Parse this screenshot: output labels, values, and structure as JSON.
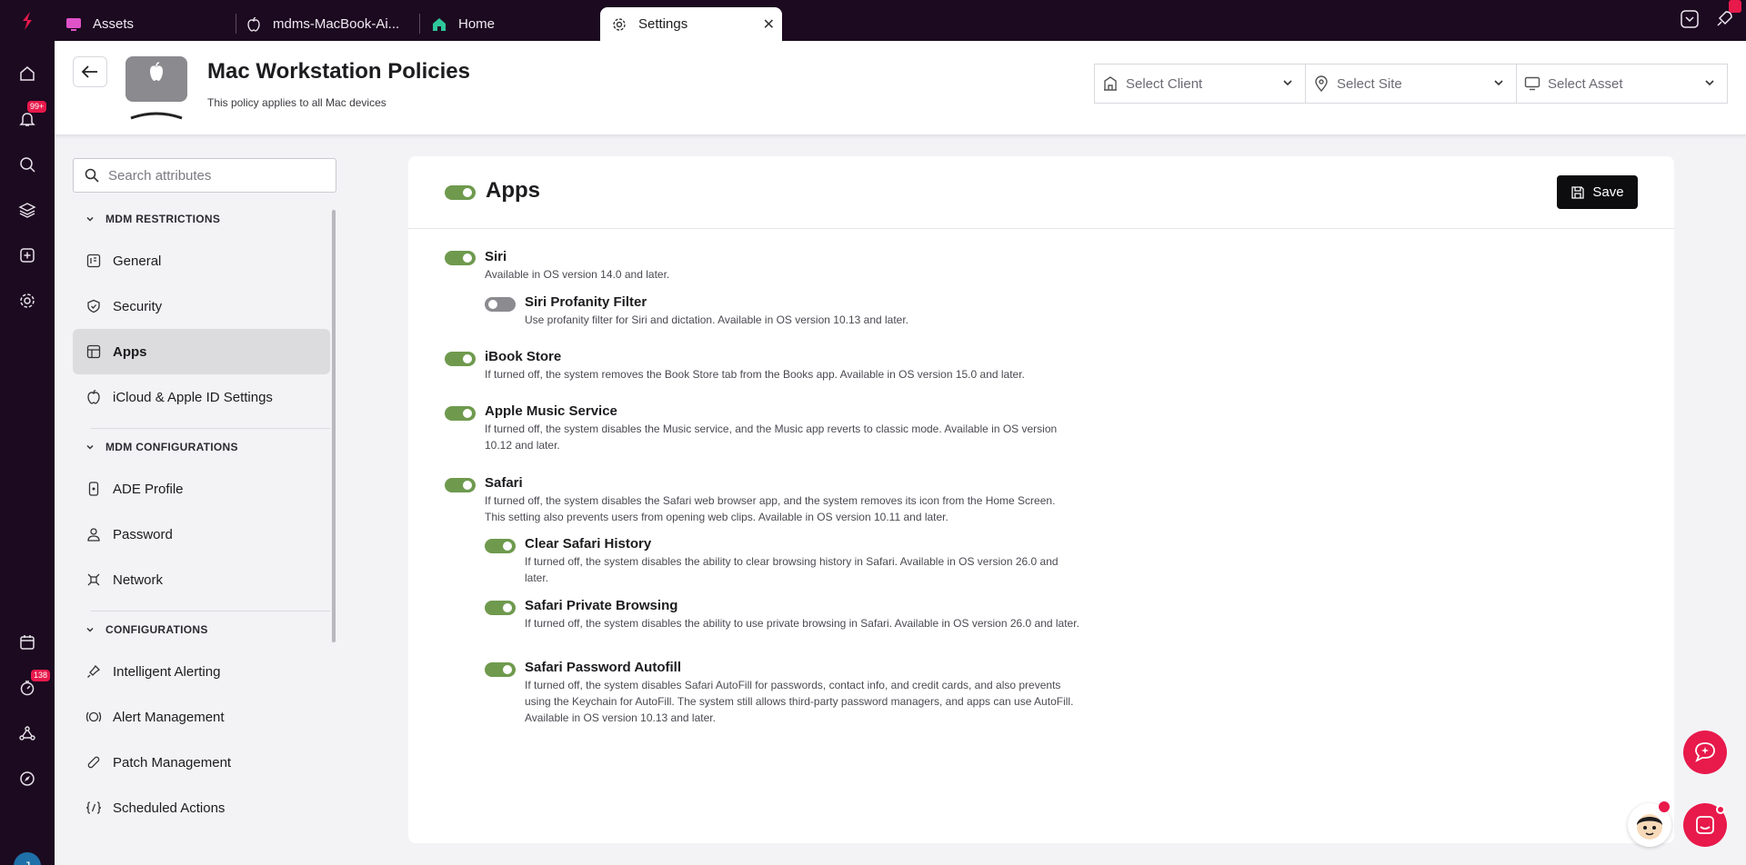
{
  "tabs": [
    {
      "label": "Assets",
      "icon": "monitor-icon"
    },
    {
      "label": "mdms-MacBook-Ai...",
      "icon": "apple-icon"
    },
    {
      "label": "Home",
      "icon": "home-icon"
    },
    {
      "label": "Settings",
      "icon": "gear-icon",
      "active": true
    }
  ],
  "rail": {
    "notifications_badge": "99+",
    "timer_badge": "138",
    "avatar_initial": "J"
  },
  "header": {
    "title": "Mac Workstation Policies",
    "subtitle": "This policy applies to all Mac devices",
    "client_placeholder": "Select Client",
    "site_placeholder": "Select Site",
    "asset_placeholder": "Select Asset"
  },
  "sidebar": {
    "search_placeholder": "Search attributes",
    "sections": [
      {
        "label": "MDM RESTRICTIONS",
        "items": [
          "General",
          "Security",
          "Apps",
          "iCloud & Apple ID Settings"
        ]
      },
      {
        "label": "MDM CONFIGURATIONS",
        "items": [
          "ADE Profile",
          "Password",
          "Network"
        ]
      },
      {
        "label": "CONFIGURATIONS",
        "items": [
          "Intelligent Alerting",
          "Alert Management",
          "Patch Management",
          "Scheduled Actions"
        ]
      }
    ],
    "active_item": "Apps"
  },
  "main": {
    "title": "Apps",
    "save_label": "Save",
    "settings": [
      {
        "title": "Siri",
        "desc": "Available in OS version 14.0 and later.",
        "on": true
      },
      {
        "title": "Siri Profanity Filter",
        "desc": "Use profanity filter for Siri and dictation. Available in OS version 10.13 and later.",
        "on": false
      },
      {
        "title": "iBook Store",
        "desc": "If turned off, the system removes the Book Store tab from the Books app. Available in OS version 15.0 and later.",
        "on": true
      },
      {
        "title": "Apple Music Service",
        "desc": "If turned off, the system disables the Music service, and the Music app reverts to classic mode. Available in OS version 10.12 and later.",
        "on": true
      },
      {
        "title": "Safari",
        "desc": "If turned off, the system disables the Safari web browser app, and the system removes its icon from the Home Screen. This setting also prevents users from opening web clips. Available in OS version 10.11 and later.",
        "on": true
      },
      {
        "title": "Clear Safari History",
        "desc": "If turned off, the system disables the ability to clear browsing history in Safari. Available in OS version 26.0 and later.",
        "on": true
      },
      {
        "title": "Safari Private Browsing",
        "desc": "If turned off, the system disables the ability to use private browsing in Safari. Available in OS version 26.0 and later.",
        "on": true
      },
      {
        "title": "Safari Password Autofill",
        "desc": "If turned off, the system disables Safari AutoFill for passwords, contact info, and credit cards, and also prevents using the Keychain for AutoFill. The system still allows third-party password managers, and apps can use AutoFill. Available in OS version 10.13 and later.",
        "on": true
      }
    ]
  },
  "colors": {
    "rail_bg": "#1c0a20",
    "toggle_on": "#6f9a4e",
    "toggle_off": "#8b8b90",
    "accent_pink": "#e8194b"
  }
}
